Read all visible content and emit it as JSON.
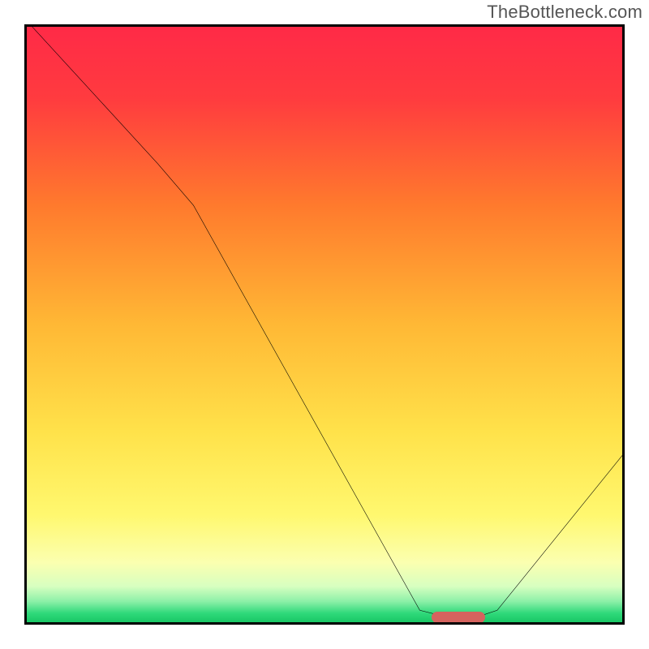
{
  "watermark": "TheBottleneck.com",
  "chart_data": {
    "type": "line",
    "title": "",
    "xlabel": "",
    "ylabel": "",
    "xlim": [
      0,
      100
    ],
    "ylim": [
      0,
      100
    ],
    "grid": false,
    "legend": false,
    "curve": [
      {
        "x": 0,
        "y": 101
      },
      {
        "x": 22,
        "y": 77
      },
      {
        "x": 28,
        "y": 70
      },
      {
        "x": 66,
        "y": 2
      },
      {
        "x": 70,
        "y": 1
      },
      {
        "x": 76,
        "y": 1
      },
      {
        "x": 79,
        "y": 2
      },
      {
        "x": 100,
        "y": 28
      }
    ],
    "marker": {
      "x_start": 68,
      "x_end": 77,
      "y": 0.8,
      "color": "#d6635e"
    },
    "gradient_stops": [
      {
        "pos": 0.0,
        "color": "#ff2a47"
      },
      {
        "pos": 0.12,
        "color": "#ff3b3f"
      },
      {
        "pos": 0.3,
        "color": "#ff7a2d"
      },
      {
        "pos": 0.5,
        "color": "#ffb835"
      },
      {
        "pos": 0.68,
        "color": "#ffe24a"
      },
      {
        "pos": 0.82,
        "color": "#fff86f"
      },
      {
        "pos": 0.9,
        "color": "#fbffb0"
      },
      {
        "pos": 0.94,
        "color": "#d7ffc0"
      },
      {
        "pos": 0.965,
        "color": "#8cf0a8"
      },
      {
        "pos": 0.985,
        "color": "#2fd97a"
      },
      {
        "pos": 1.0,
        "color": "#19c765"
      }
    ]
  }
}
